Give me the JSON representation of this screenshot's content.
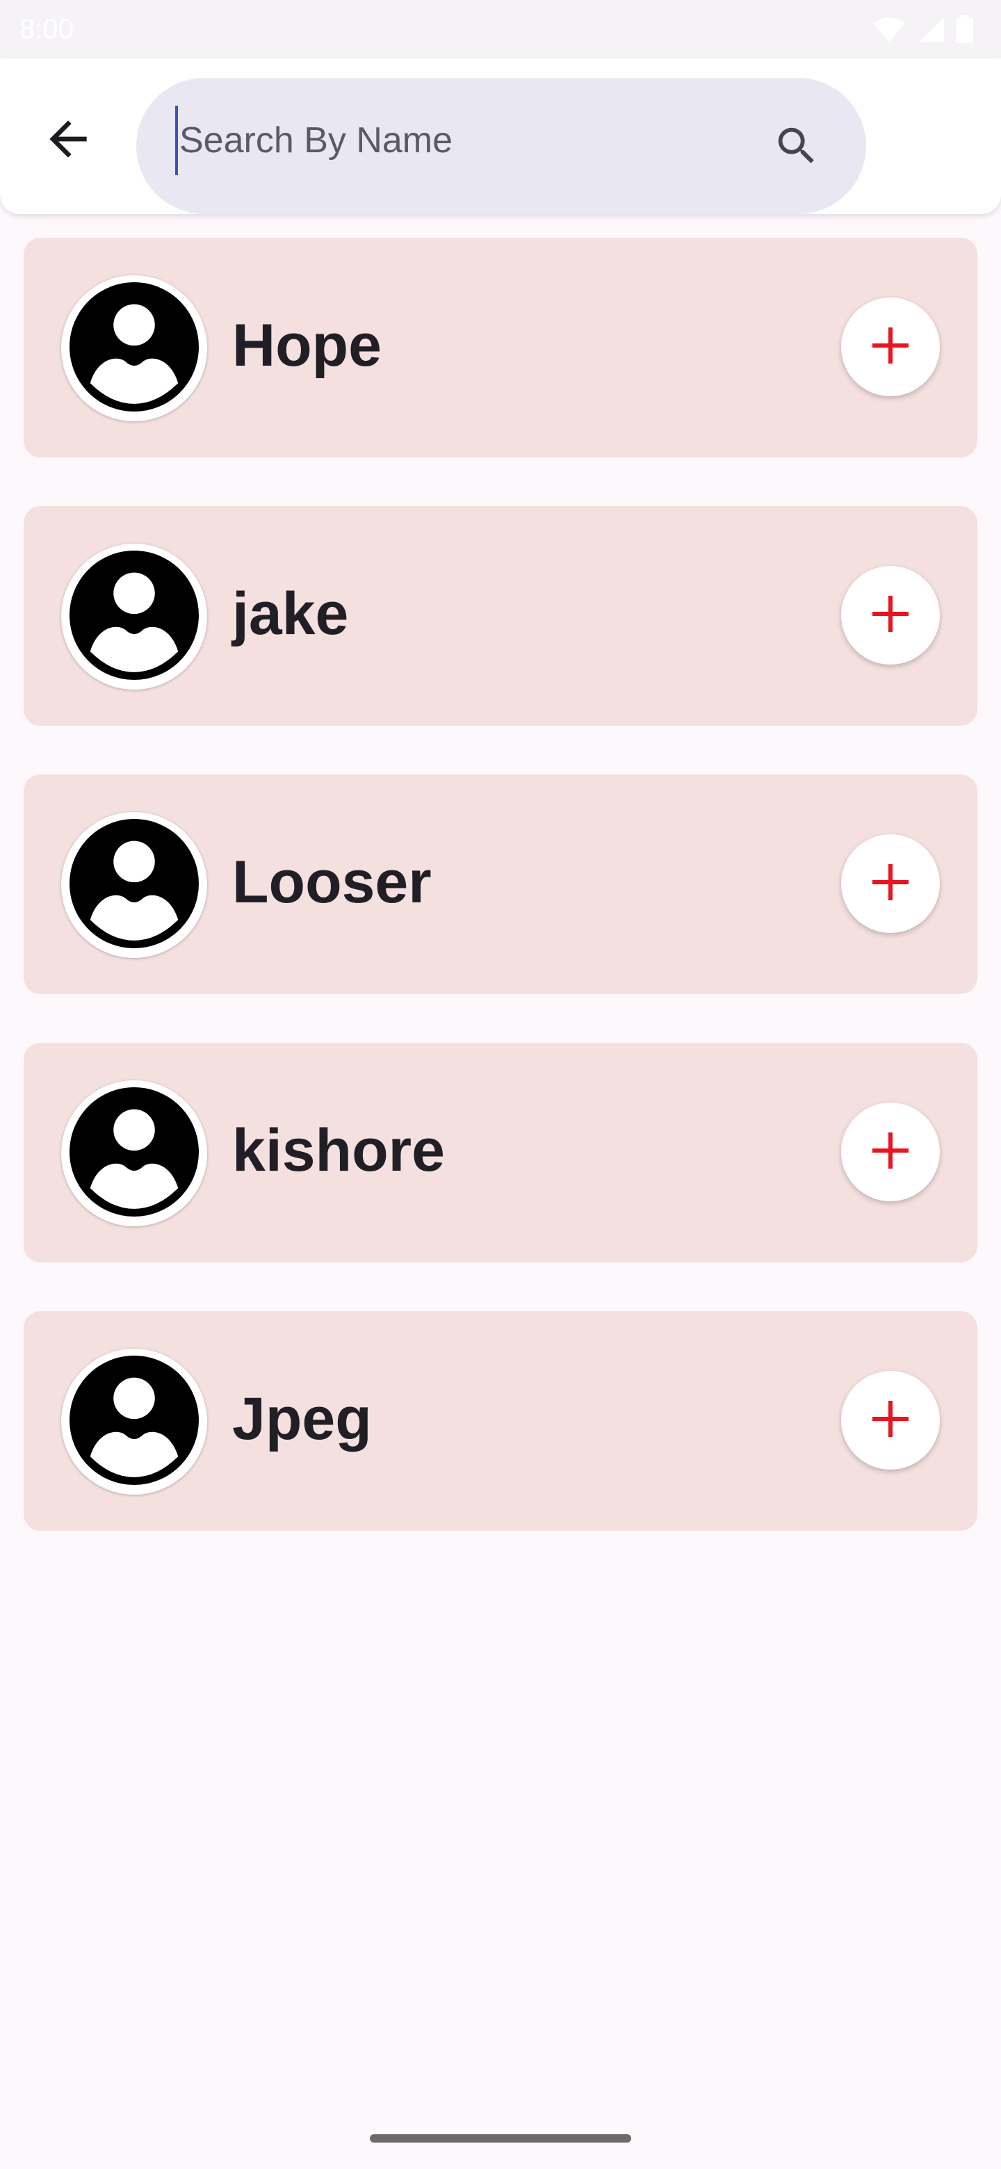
{
  "status_bar": {
    "time": "8:00",
    "icons": [
      "wifi-icon",
      "signal-icon",
      "battery-icon"
    ]
  },
  "header": {
    "back_icon": "arrow-left-icon",
    "search": {
      "value": "",
      "placeholder": "Search By Name",
      "icon": "search-icon"
    }
  },
  "users": [
    {
      "name": "Hope",
      "avatar_icon": "account-circle-icon",
      "action_icon": "plus-icon"
    },
    {
      "name": "jake",
      "avatar_icon": "account-circle-icon",
      "action_icon": "plus-icon"
    },
    {
      "name": "Looser",
      "avatar_icon": "account-circle-icon",
      "action_icon": "plus-icon"
    },
    {
      "name": "kishore",
      "avatar_icon": "account-circle-icon",
      "action_icon": "plus-icon"
    },
    {
      "name": "Jpeg",
      "avatar_icon": "account-circle-icon",
      "action_icon": "plus-icon"
    }
  ],
  "colors": {
    "card_background": "#f5e0e0",
    "plus_accent": "#e8141e",
    "search_background": "#e9e8f2",
    "page_background": "#fdf8fc"
  }
}
